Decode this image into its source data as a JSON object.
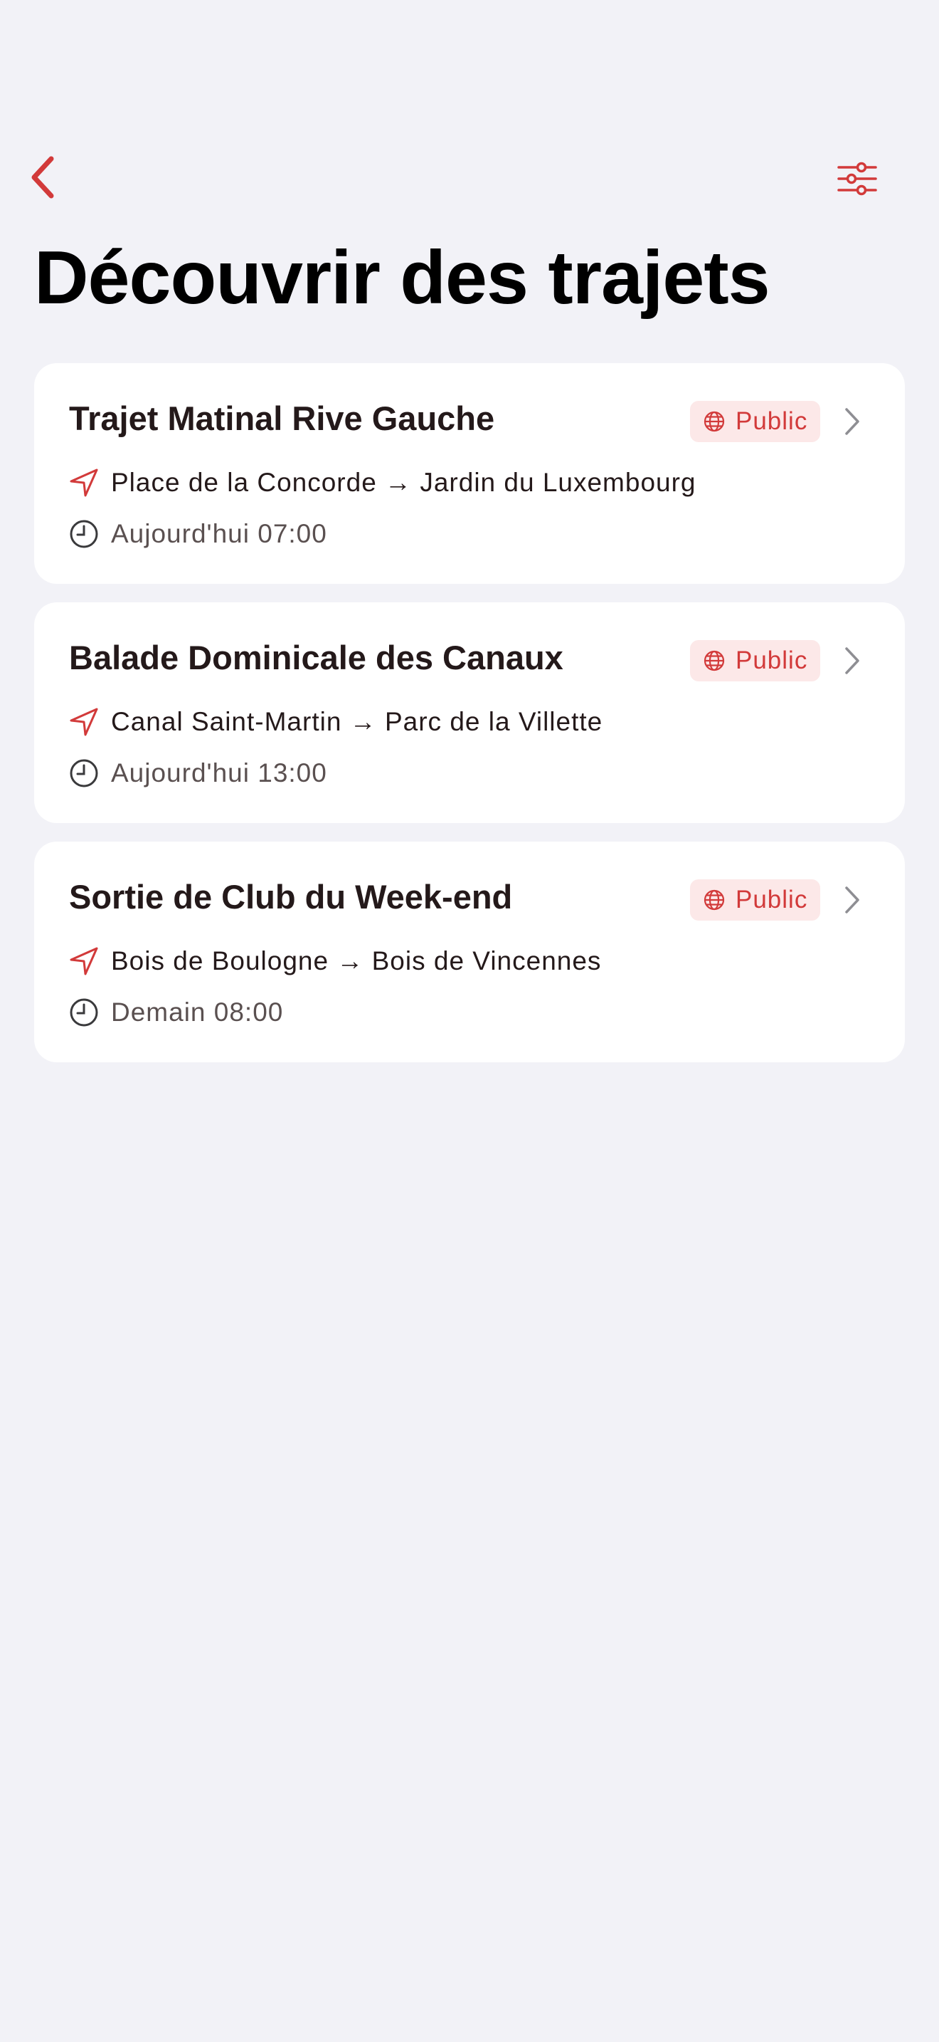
{
  "nav": {
    "back_icon": "chevron-left-icon",
    "filter_icon": "sliders-icon"
  },
  "page": {
    "title": "Découvrir des trajets"
  },
  "colors": {
    "accent": "#d23a3a",
    "badge_background": "#fce8e8",
    "background": "#f2f2f7",
    "card": "#ffffff",
    "text_primary": "#24191a",
    "text_secondary": "#5a5050"
  },
  "trips": [
    {
      "title": "Trajet Matinal Rive Gauche",
      "badge": "Public",
      "route": "Place de la Concorde → Jardin du Luxembourg",
      "time": "Aujourd'hui 07:00"
    },
    {
      "title": "Balade Dominicale des Canaux",
      "badge": "Public",
      "route": "Canal Saint-Martin → Parc de la Villette",
      "time": "Aujourd'hui 13:00"
    },
    {
      "title": "Sortie de Club du Week-end",
      "badge": "Public",
      "route": "Bois de Boulogne → Bois de Vincennes",
      "time": "Demain 08:00"
    }
  ]
}
